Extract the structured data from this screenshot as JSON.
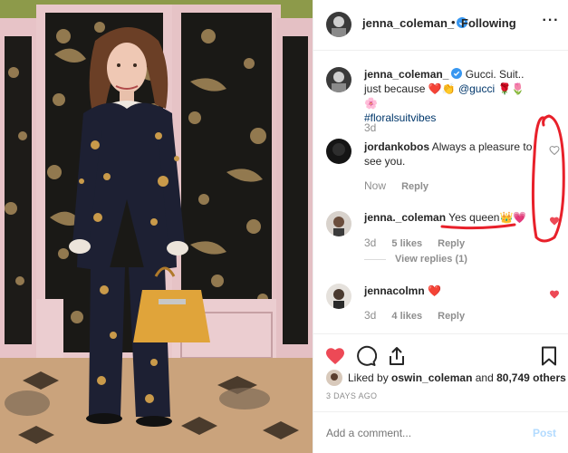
{
  "header": {
    "username": "jenna_coleman_",
    "separator": "•",
    "follow_state": "Following",
    "more_glyph": "···"
  },
  "caption": {
    "username": "jenna_coleman_",
    "text_a": " Gucci. Suit.. just because ",
    "emoji_a": "❤️👏",
    "tag": "@gucci",
    "emoji_b": " 🌹🌷🌸",
    "hashtag": "#floralsuitvibes",
    "age": "3d"
  },
  "comments": [
    {
      "username": "jordankobos",
      "text": "Always a pleasure to see you.",
      "age": "Now",
      "likes": "",
      "reply": "Reply",
      "liked": false
    },
    {
      "username": "jenna._coleman",
      "text": "Yes queen👑💗",
      "age": "3d",
      "likes": "5 likes",
      "reply": "Reply",
      "liked": true,
      "view_replies": "View replies (1)"
    },
    {
      "username": "jennacolmn",
      "text": "❤️",
      "age": "3d",
      "likes": "4 likes",
      "reply": "Reply",
      "liked": true
    }
  ],
  "likes_line": {
    "prefix": "Liked by ",
    "user": "oswin_coleman",
    "mid": " and ",
    "count": "80,749 others"
  },
  "post_date": "3 DAYS AGO",
  "add_comment": {
    "placeholder": "Add a comment...",
    "post_label": "Post"
  },
  "colors": {
    "heart_red": "#ed4956",
    "annotation_red": "#e8202a",
    "link_blue": "#00376b",
    "post_disabled": "#b3dbff",
    "verified_blue": "#3897f0"
  },
  "icons": [
    "heart-icon",
    "comment-icon",
    "share-icon",
    "bookmark-icon",
    "more-icon",
    "verified-badge-icon"
  ]
}
